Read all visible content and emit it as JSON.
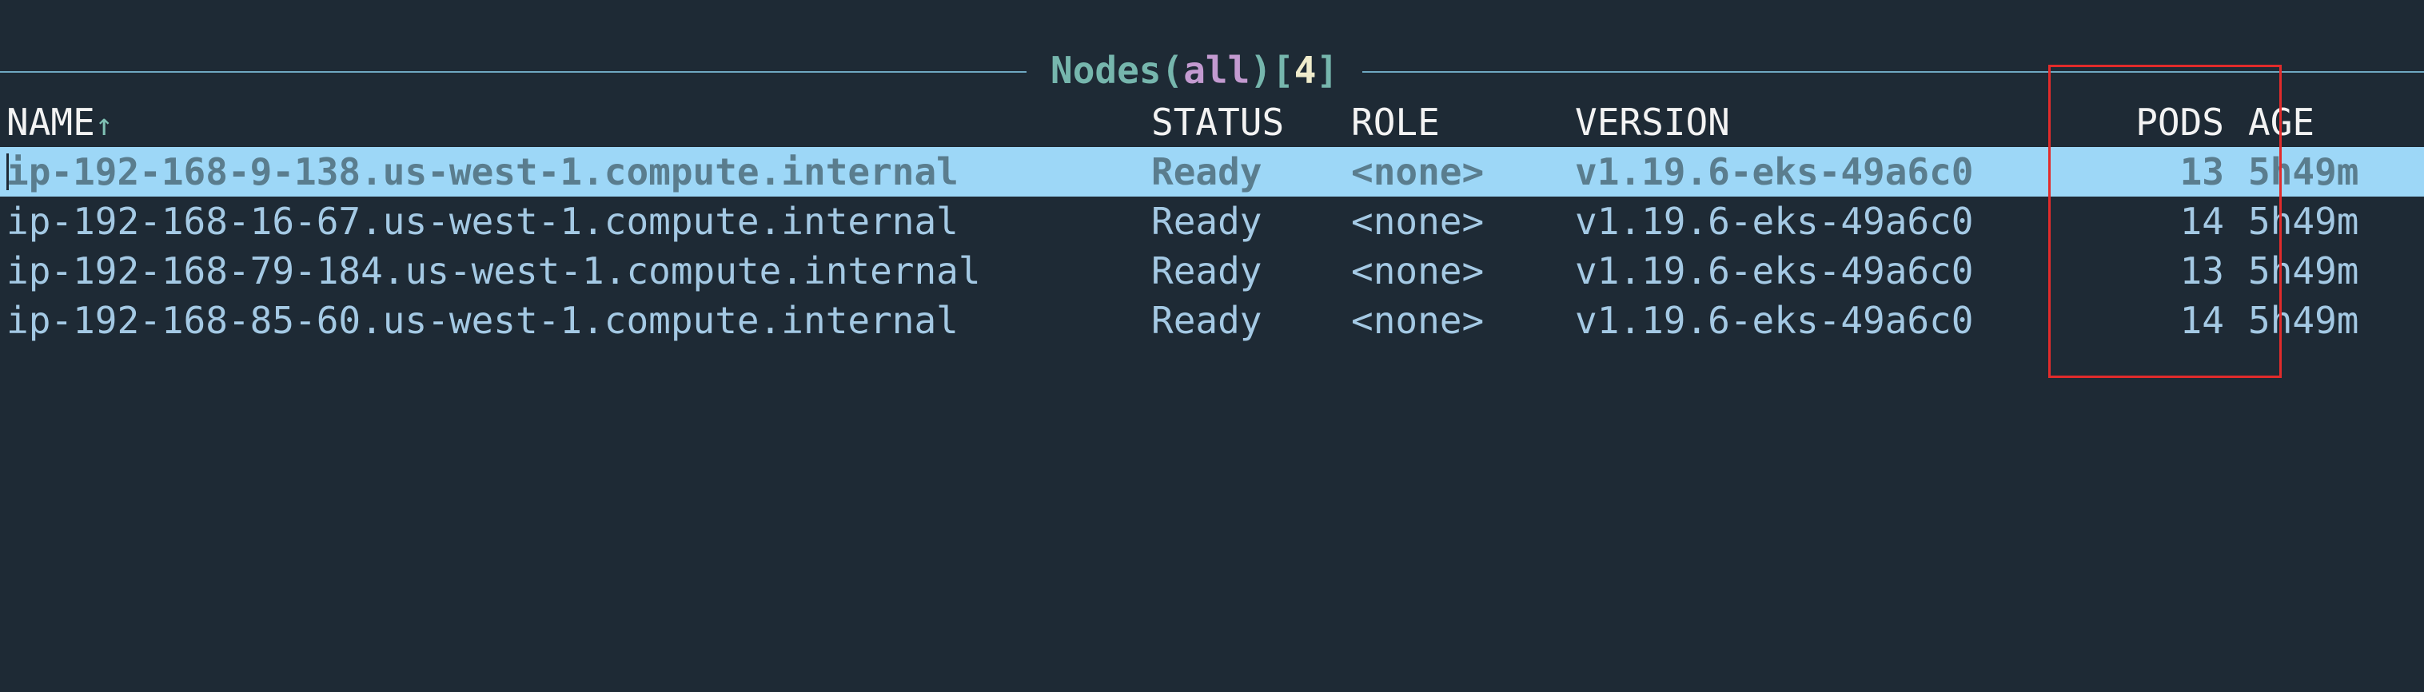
{
  "title": {
    "name": "Nodes",
    "open_paren": "(",
    "filter": "all",
    "close_paren": ")",
    "open_bracket": "[",
    "count": "4",
    "close_bracket": "]"
  },
  "columns": {
    "name": "NAME",
    "sort_indicator": "↑",
    "status": "STATUS",
    "role": "ROLE",
    "version": "VERSION",
    "pods": "PODS",
    "age": "AGE"
  },
  "rows": [
    {
      "name": "ip-192-168-9-138.us-west-1.compute.internal",
      "status": "Ready",
      "role": "<none>",
      "version": "v1.19.6-eks-49a6c0",
      "pods": "13",
      "age": "5h49m",
      "selected": true
    },
    {
      "name": "ip-192-168-16-67.us-west-1.compute.internal",
      "status": "Ready",
      "role": "<none>",
      "version": "v1.19.6-eks-49a6c0",
      "pods": "14",
      "age": "5h49m",
      "selected": false
    },
    {
      "name": "ip-192-168-79-184.us-west-1.compute.internal",
      "status": "Ready",
      "role": "<none>",
      "version": "v1.19.6-eks-49a6c0",
      "pods": "13",
      "age": "5h49m",
      "selected": false
    },
    {
      "name": "ip-192-168-85-60.us-west-1.compute.internal",
      "status": "Ready",
      "role": "<none>",
      "version": "v1.19.6-eks-49a6c0",
      "pods": "14",
      "age": "5h49m",
      "selected": false
    }
  ],
  "colors": {
    "background": "#1e2a35",
    "frame_line": "#6fa8c2",
    "selected_row_bg": "#9dd7f7",
    "row_text": "#a4c9e4",
    "header_text": "#f3f3f3",
    "annotation_box": "#e22b2b"
  }
}
